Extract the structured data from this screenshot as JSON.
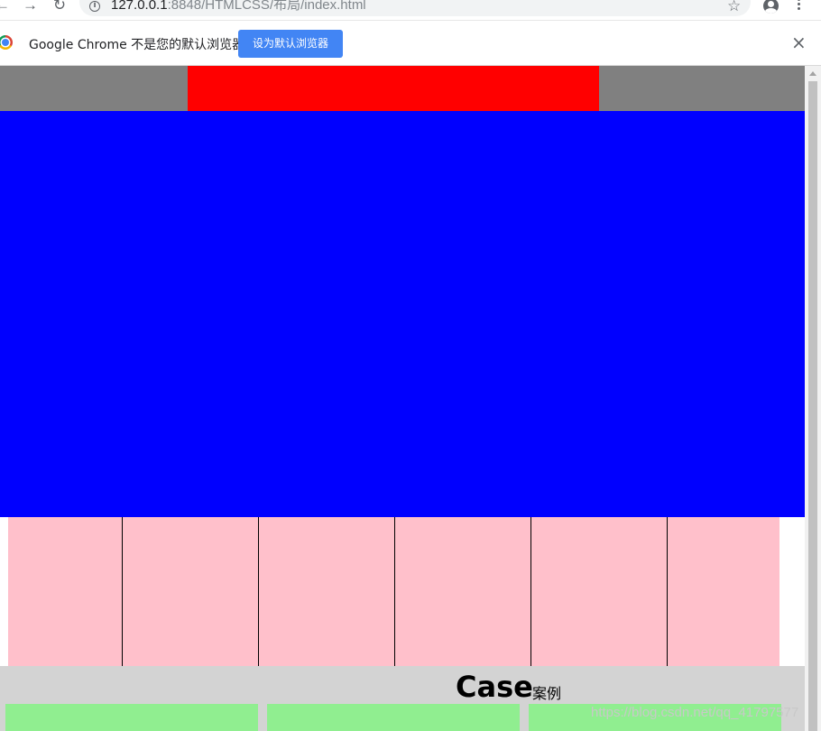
{
  "browser": {
    "url_host": "127.0.0.1",
    "url_rest": ":8848/HTMLCSS/布局/index.html",
    "back_icon": "←",
    "forward_icon": "→",
    "reload_icon": "↻",
    "info_icon": "i",
    "star_icon": "☆",
    "infobar_message": "Google Chrome 不是您的默认浏览器",
    "infobar_button": "设为默认浏览器",
    "close_icon": "×"
  },
  "page": {
    "colors": {
      "header": "#808080",
      "header_center": "#ff0000",
      "banner": "#0000ff",
      "pink_cells": "#ffc0cb",
      "case_bg": "#d3d3d3",
      "green_cards": "#90ee90"
    },
    "pink_cell_count": 6,
    "case_title": "Case",
    "case_subtitle": "案例",
    "green_card_count": 3
  },
  "watermark": "https://blog.csdn.net/qq_41797577"
}
